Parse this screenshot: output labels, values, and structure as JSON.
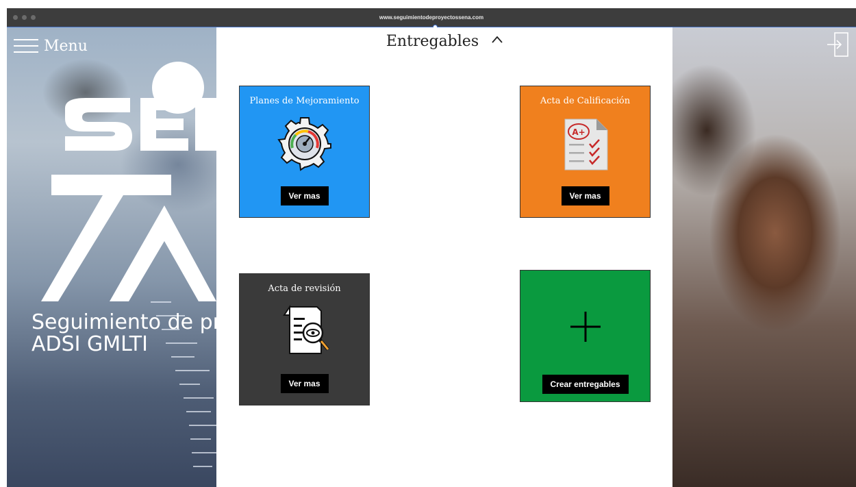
{
  "browser": {
    "url": "www.seguimientodeproyectossena.com"
  },
  "nav": {
    "menu_label": "Menu"
  },
  "hero": {
    "line1": "Seguimiento de proyectos",
    "line2": "ADSI GMLTI"
  },
  "panel": {
    "title": "Entregables"
  },
  "cards": [
    {
      "title": "Planes de Mejoramiento",
      "button": "Ver mas",
      "color": "#2196f3",
      "icon": "gear-gauge-icon"
    },
    {
      "title": "Acta de Calificación",
      "button": "Ver mas",
      "color": "#f0801e",
      "icon": "graded-document-icon"
    },
    {
      "title": "Acta de revisión",
      "button": "Ver mas",
      "color": "#3a3a3a",
      "icon": "document-review-icon"
    },
    {
      "title": "",
      "button": "Crear entregables",
      "color": "#0a9a3f",
      "icon": "plus-icon"
    }
  ],
  "colors": {
    "selection": "#4a7bd8"
  }
}
